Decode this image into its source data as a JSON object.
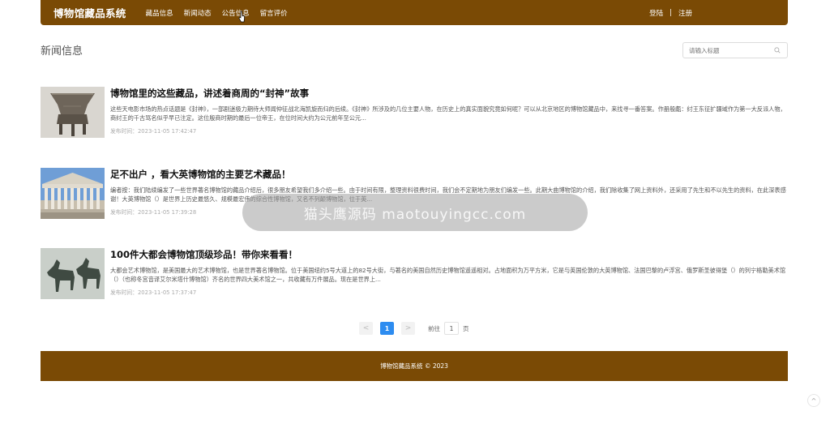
{
  "header": {
    "brand": "博物馆藏品系统",
    "nav": [
      "藏品信息",
      "新闻动态",
      "公告信息",
      "留言评价"
    ],
    "login": "登陆",
    "separator": "|",
    "register": "注册"
  },
  "page": {
    "title": "新闻信息",
    "search_placeholder": "请输入标题"
  },
  "news": [
    {
      "title": "博物馆里的这些藏品，讲述着商周的“封神”故事",
      "excerpt": "这些天电影市场的热点话题是《封神》，一部剧迷极力期待大师闻仲征战北海凯旋而归的后续。《封神》所涉及的几位主要人物，在历史上的真实面貌究竟如何呢？可以从北京地区的博物馆藏品中，来找寻一番答案。作册般甗：纣王东征扩疆域作为第一大反派人物，商纣王的千古骂名似乎早已注定。这位殷商时期的最后一位帝王，在位时间大约为公元前年至公元...",
      "date": "发布时间：2023-11-05 17:42:47",
      "image": "bronze-vessel"
    },
    {
      "title": "足不出户 ，看大英博物馆的主要艺术藏品！",
      "excerpt": "编者按：我们陆续编发了一些世界著名博物馆的藏品介绍后，很多朋友希望我们多介绍一些。由于时间有限，整理资料很费时间，我们会不定期地为朋友们编发一些。此期大曲博物馆的介绍，我们除收集了网上资料外，还采用了先生和不以先生的资料，在此深表感谢！大英博物馆（）是世界上历史最悠久、规模最宏伟的综合性博物馆，又名不列颠博物馆，位于英...",
      "date": "发布时间：2023-11-05 17:39:28",
      "image": "museum-building"
    },
    {
      "title": "100件大都会博物馆顶级珍品！带你来看看！",
      "excerpt": "大都会艺术博物馆，是美国最大的艺术博物馆，也是世界著名博物馆。位于美国纽约5号大道上的82号大街，与著名的美国自然历史博物馆遥遥相对。占地面积为万平方米，它是与英国伦敦的大英博物馆、法国巴黎的卢浮宫、俄罗斯圣彼得堡（）的列宁格勒美术馆（）（也称冬宫音译艾尔米塔什博物馆）齐名的世界四大美术馆之一，共收藏有万件展品。现在是世界上...",
      "date": "发布时间：2023-11-05 17:37:47",
      "image": "horse-statues"
    }
  ],
  "pagination": {
    "prev": "<",
    "current": "1",
    "next": ">",
    "goto_label": "前往",
    "goto_value": "1",
    "suffix": "页"
  },
  "footer": {
    "copyright": "博物馆藏品系统 © 2023"
  },
  "watermark": "猫头鹰源码 maotouyingcc.com",
  "colors": {
    "brand": "#7a4a05",
    "accent": "#2d8cf0"
  }
}
